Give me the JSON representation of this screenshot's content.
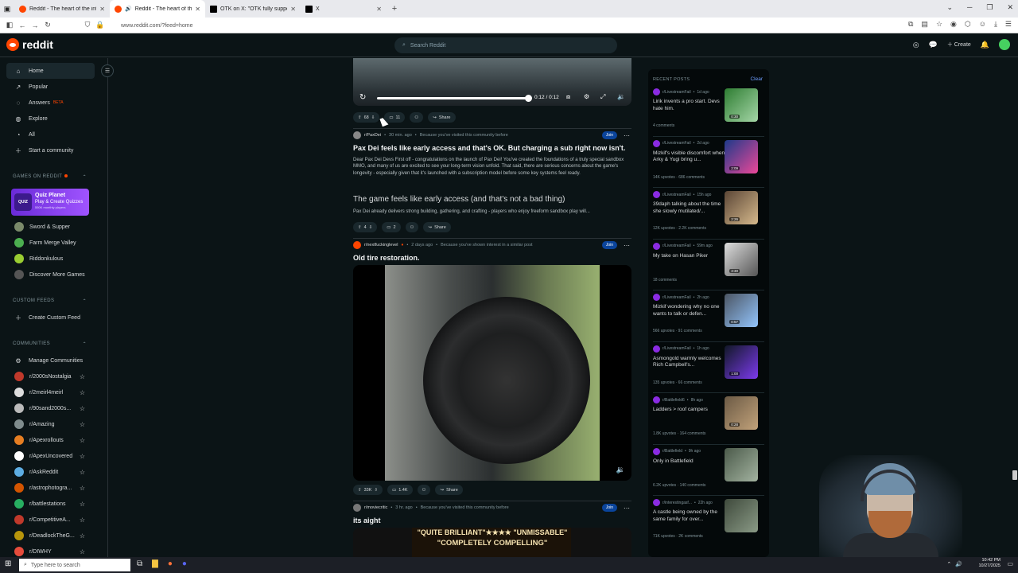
{
  "browser": {
    "tabs": [
      {
        "title": "Reddit - The heart of the intern"
      },
      {
        "title": "Reddit - The heart of the in"
      },
      {
        "title": "OTK on X: \"OTK fully supports a"
      },
      {
        "title": "X"
      }
    ],
    "url": "www.reddit.com/?feed=home"
  },
  "header": {
    "logo_text": "reddit",
    "search_placeholder": "Search Reddit",
    "create_label": "Create",
    "notif_count": "1"
  },
  "sidebar": {
    "nav": [
      {
        "label": "Home",
        "icon": "home-icon"
      },
      {
        "label": "Popular",
        "icon": "popular-icon"
      },
      {
        "label": "Answers",
        "badge": "BETA",
        "icon": "answers-icon"
      },
      {
        "label": "Explore",
        "icon": "explore-icon"
      },
      {
        "label": "All",
        "icon": "all-icon"
      },
      {
        "label": "Start a community",
        "icon": "plus-icon"
      }
    ],
    "games_header": "GAMES ON REDDIT",
    "quiz": {
      "title": "Quiz Planet",
      "subtitle": "Play & Create Quizzes",
      "players": "550K monthly players",
      "logo": "QUIZ"
    },
    "games": [
      {
        "label": "Sword & Supper",
        "color": "#7a8a6a"
      },
      {
        "label": "Farm Merge Valley",
        "color": "#4caf50"
      },
      {
        "label": "Riddonkulous",
        "color": "#9acd32"
      },
      {
        "label": "Discover More Games",
        "color": "#555555"
      }
    ],
    "custom_feeds_header": "CUSTOM FEEDS",
    "create_custom_feed": "Create Custom Feed",
    "communities_header": "COMMUNITIES",
    "manage_communities": "Manage Communities",
    "communities": [
      {
        "name": "r/2000sNostalgia",
        "color": "#c0392b"
      },
      {
        "name": "r/2meirl4meirl",
        "color": "#dddddd"
      },
      {
        "name": "r/90sand2000s...",
        "color": "#bbbbbb"
      },
      {
        "name": "r/Amazing",
        "color": "#7f8c8d"
      },
      {
        "name": "r/Apexrollouts",
        "color": "#e67e22"
      },
      {
        "name": "r/ApexUncovered",
        "color": "#ffffff"
      },
      {
        "name": "r/AskReddit",
        "color": "#5dade2"
      },
      {
        "name": "r/astrophotogra...",
        "color": "#d35400"
      },
      {
        "name": "r/battlestations",
        "color": "#27ae60"
      },
      {
        "name": "r/CompetitiveA...",
        "color": "#c0392b"
      },
      {
        "name": "r/DeadlockTheG...",
        "color": "#b7950b"
      },
      {
        "name": "r/DIWHY",
        "color": "#e74c3c"
      }
    ]
  },
  "feed": {
    "post0": {
      "video_time": "0:12 / 0:12",
      "upvotes": "68",
      "comments": "11",
      "share": "Share"
    },
    "post1": {
      "subreddit": "r/PaxDei",
      "time": "30 min. ago",
      "reason": "Because you've visited this community before",
      "join": "Join",
      "title": "Pax Dei feels like early access and that's OK. But charging a sub right now isn't.",
      "body": "Dear Pax Dei Devs First off - congratulations on the launch of Pax Dei! You've created the foundations of a truly special sandbox MMO, and many of us are excited to see your long-term vision unfold. That said, there are serious concerns about the game's longevity - especially given that it's launched with a subscription model before some key systems feel ready.",
      "heading": "The game feels like early access (and that's not a bad thing)",
      "body2": "Pax Dei already delivers strong building, gathering, and crafting - players who enjoy freeform sandbox play will...",
      "upvotes": "4",
      "comments": "2",
      "share": "Share"
    },
    "post2": {
      "subreddit": "r/nextfuckinglevel",
      "time": "2 days ago",
      "reason": "Because you've shown interest in a similar post",
      "join": "Join",
      "title": "Old tire restoration.",
      "upvotes": "33K",
      "comments": "1.4K",
      "share": "Share"
    },
    "post3": {
      "subreddit": "r/moviecritic",
      "time": "3 hr. ago",
      "reason": "Because you've visited this community before",
      "join": "Join",
      "title": "its aight",
      "banner1": "\"QUITE BRILLIANT\"★★★★ \"UNMISSABLE\"",
      "banner2": "\"COMPLETELY COMPELLING\""
    }
  },
  "recent": {
    "header": "RECENT POSTS",
    "clear": "Clear",
    "posts": [
      {
        "sub": "r/LivestreamFail",
        "time": "1d ago",
        "title": "Lirik invents a pro start. Devs hate him.",
        "stats": "4 comments",
        "dur": "0:30",
        "c1": "#2e7d32",
        "c2": "#a5d6a7"
      },
      {
        "sub": "r/LivestreamFail",
        "time": "2d ago",
        "title": "Mizkif's visible discomfort when Arky & Yugi bring u...",
        "stats": "14K upvotes · 686 comments",
        "dur": "2:09",
        "c1": "#1e3a8a",
        "c2": "#ec4899"
      },
      {
        "sub": "r/LivestreamFail",
        "time": "15h ago",
        "title": "39daph talking about the time she slowly mutilated/...",
        "stats": "12K upvotes · 2.2K comments",
        "dur": "2:26",
        "c1": "#5b4636",
        "c2": "#d6b98c"
      },
      {
        "sub": "r/LivestreamFail",
        "time": "59m ago",
        "title": "My take on Hasan Piker",
        "stats": "18 comments",
        "dur": "3:30",
        "c1": "#dddddd",
        "c2": "#555555"
      },
      {
        "sub": "r/LivestreamFail",
        "time": "2h ago",
        "title": "Mizkif wondering why no one wants to talk or defen...",
        "stats": "566 upvotes · 91 comments",
        "dur": "0:57",
        "c1": "#4b5563",
        "c2": "#93c5fd"
      },
      {
        "sub": "r/LivestreamFail",
        "time": "1h ago",
        "title": "Asmongold warmly welcomes Rich Campbell's...",
        "stats": "135 upvotes · 66 comments",
        "dur": "1:00",
        "c1": "#111827",
        "c2": "#7c3aed"
      },
      {
        "sub": "r/Battlefield6",
        "time": "8h ago",
        "title": "Ladders > roof campers",
        "stats": "1.8K upvotes · 164 comments",
        "dur": "0:28",
        "c1": "#6b5a45",
        "c2": "#c2a27a"
      },
      {
        "sub": "r/Battlefield",
        "time": "9h ago",
        "title": "Only in Battlefield",
        "stats": "6.2K upvotes · 140 comments",
        "dur": "",
        "c1": "#4b5a4a",
        "c2": "#a3b3a0"
      },
      {
        "sub": "r/interestingasf...",
        "time": "22h ago",
        "title": "A castle being owned by the same family for over...",
        "stats": "71K upvotes · 2K comments",
        "dur": "",
        "c1": "#3f4a3c",
        "c2": "#8a9a86"
      }
    ]
  },
  "taskbar": {
    "search_placeholder": "Type here to search",
    "time": "10:42 PM",
    "date": "10/27/2025"
  }
}
